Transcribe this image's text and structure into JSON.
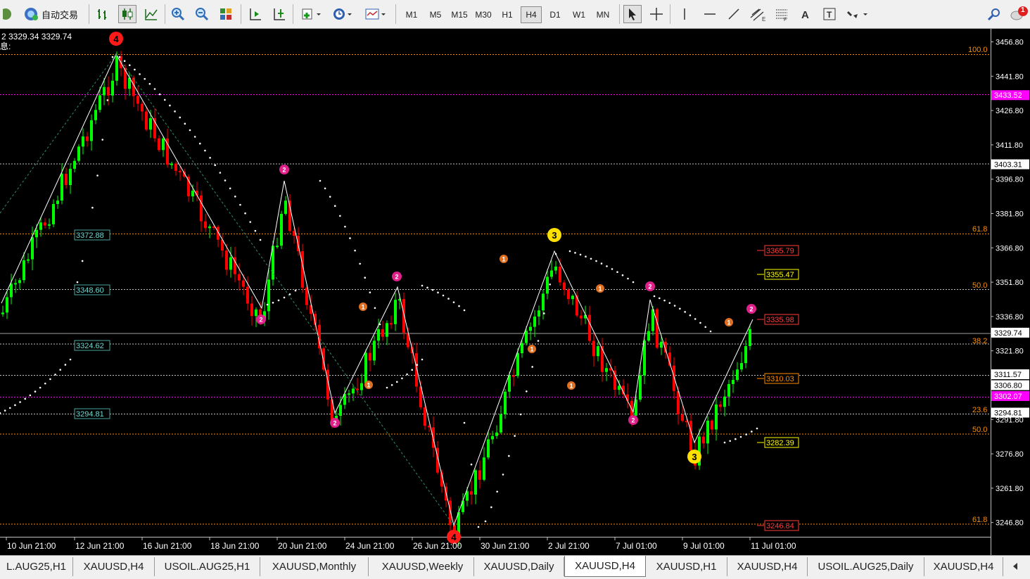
{
  "toolbar": {
    "autotrade_label": "自动交易",
    "timeframes": [
      "M1",
      "M5",
      "M15",
      "M30",
      "H1",
      "H4",
      "D1",
      "W1",
      "MN"
    ],
    "active_timeframe": "H4",
    "notification_count": "1"
  },
  "chart": {
    "ohlc_text": "2 3329.34 3329.74",
    "info_text": "息:",
    "price_levels": [
      "3456.80",
      "3441.80",
      "3426.80",
      "3411.80",
      "3396.80",
      "3381.80",
      "3366.80",
      "3351.80",
      "3336.80",
      "3321.80",
      "3306.80",
      "3291.80",
      "3276.80",
      "3261.80",
      "3246.80"
    ],
    "highlight_labels": [
      {
        "text": "3433.52",
        "bg": "#ff00ff",
        "fg": "#ffffff",
        "price": 3433.52
      },
      {
        "text": "3403.31",
        "bg": "#ffffff",
        "fg": "#000000",
        "price": 3403.31
      },
      {
        "text": "3329.74",
        "bg": "#ffffff",
        "fg": "#000000",
        "price": 3329.74
      },
      {
        "text": "3311.57",
        "bg": "#ffffff",
        "fg": "#000000",
        "price": 3311.57
      },
      {
        "text": "3306.80",
        "bg": "#ffffff",
        "fg": "#000000",
        "price": 3306.8
      },
      {
        "text": "3302.07",
        "bg": "#ff00ff",
        "fg": "#ffffff",
        "price": 3302.07
      },
      {
        "text": "3294.81",
        "bg": "#ffffff",
        "fg": "#000000",
        "price": 3294.81
      }
    ],
    "fib_labels_left": [
      "3372.88",
      "3348.60",
      "3324.62",
      "3294.81"
    ],
    "fib_pct": [
      "100.0",
      "61.8",
      "50.0",
      "38.2",
      "23.6",
      "50.0",
      "61.8"
    ],
    "target_labels": [
      {
        "text": "3365.79",
        "color": "#ff3b3b"
      },
      {
        "text": "3355.47",
        "color": "#ffff00"
      },
      {
        "text": "3335.98",
        "color": "#ff3b3b"
      },
      {
        "text": "3310.03",
        "color": "#ff8c00"
      },
      {
        "text": "3282.39",
        "color": "#ffff00"
      },
      {
        "text": "3246.84",
        "color": "#ff3b3b"
      }
    ],
    "wave_labels": [
      "4",
      "2",
      "2",
      "1",
      "2",
      "1",
      "2",
      "3",
      "1",
      "1",
      "1",
      "2",
      "2",
      "1",
      "1",
      "2",
      "3",
      "4"
    ],
    "date_labels": [
      "10 Jun 21:00",
      "12 Jun 21:00",
      "16 Jun 21:00",
      "18 Jun 21:00",
      "20 Jun 21:00",
      "24 Jun 21:00",
      "26 Jun 21:00",
      "30 Jun 21:00",
      "2 Jul 21:00",
      "7 Jul 01:00",
      "9 Jul 01:00",
      "11 Jul 01:00"
    ],
    "colors": {
      "bull": "#00ff00",
      "bear": "#ff0000",
      "zigzag": "#ffffff",
      "grid_magenta": "#ff00ff",
      "fib_orange": "#ff8c00"
    }
  },
  "tabs": [
    "L.AUG25,H1",
    "XAUUSD,H4",
    "USOIL.AUG25,H1",
    "XAUUSD,Monthly",
    "XAUUSD,Weekly",
    "XAUUSD,Daily",
    "XAUUSD,H4",
    "XAUUSD,H1",
    "XAUUSD,H4",
    "USOIL.AUG25,Daily",
    "XAUUSD,H4"
  ],
  "active_tab_index": 6
}
